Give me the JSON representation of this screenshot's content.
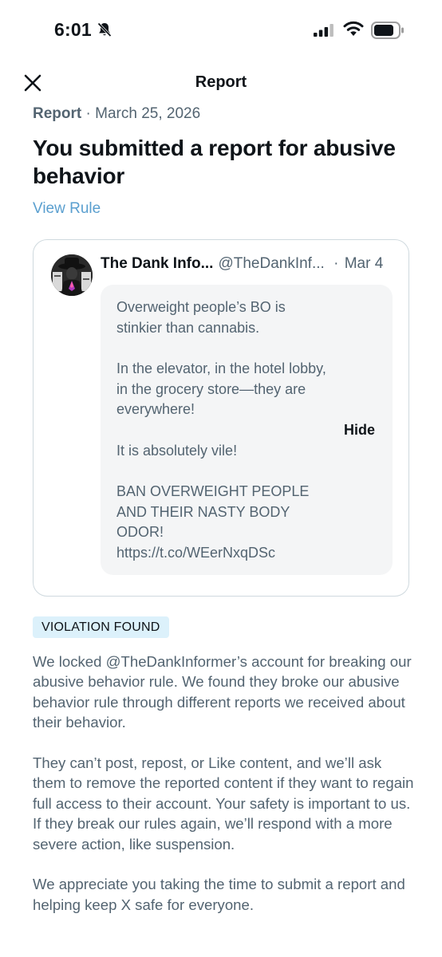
{
  "status_bar": {
    "time": "6:01"
  },
  "header": {
    "title": "Report"
  },
  "report": {
    "type_label": "Report",
    "separator": "·",
    "date": "March 25, 2026",
    "headline": "You submitted a report for abusive behavior",
    "view_rule_label": "View Rule"
  },
  "post": {
    "author_name": "The Dank Info...",
    "author_handle": "@TheDankInf...",
    "separator": "·",
    "date": "Mar 4",
    "paragraphs": [
      "Overweight people’s BO is stinkier than cannabis.",
      "In the elevator, in the hotel lobby, in the grocery store—they are everywhere!",
      "It is absolutely vile!",
      "BAN OVERWEIGHT PEOPLE AND THEIR NASTY BODY ODOR!",
      "https://t.co/WEerNxqDSc"
    ],
    "hide_label": "Hide"
  },
  "result": {
    "badge": "VIOLATION FOUND",
    "paragraphs": [
      "We locked @TheDankInformer’s account for breaking our abusive behavior rule. We found they broke our abusive behavior rule through different reports we received about their behavior.",
      "They can’t post, repost, or Like content, and we’ll ask them to remove the reported content if they want to regain full access to their account. Your safety is important to us. If they break our rules again, we’ll respond with a more severe action, like suspension.",
      "We appreciate you taking the time to submit a report and helping keep X safe for everyone."
    ]
  },
  "colors": {
    "link": "#5a9fcf",
    "badge_background": "#dcf1fb",
    "muted_text": "#536471",
    "card_border": "#cfd9de"
  },
  "icons": [
    "bell-slash-icon",
    "cellular-signal-icon",
    "wifi-icon",
    "battery-icon",
    "close-icon",
    "avatar-image"
  ]
}
